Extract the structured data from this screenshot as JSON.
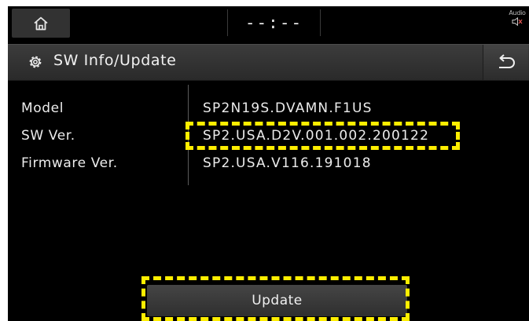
{
  "status_bar": {
    "home_icon": "home-icon",
    "clock": "--:--",
    "audio_label": "Audio",
    "audio_icon": "speaker-muted-icon"
  },
  "title_bar": {
    "settings_icon": "gear-icon",
    "title": "SW Info/Update",
    "back_icon": "back-arrow-icon"
  },
  "info": {
    "rows": [
      {
        "label": "Model",
        "value": "SP2N19S.DVAMN.F1US"
      },
      {
        "label": "SW Ver.",
        "value": "SP2.USA.D2V.001.002.200122"
      },
      {
        "label": "Firmware Ver.",
        "value": "SP2.USA.V116.191018"
      }
    ]
  },
  "update_button": {
    "label": "Update"
  },
  "colors": {
    "background": "#000000",
    "highlight": "#ffee00",
    "text": "#ececec"
  }
}
